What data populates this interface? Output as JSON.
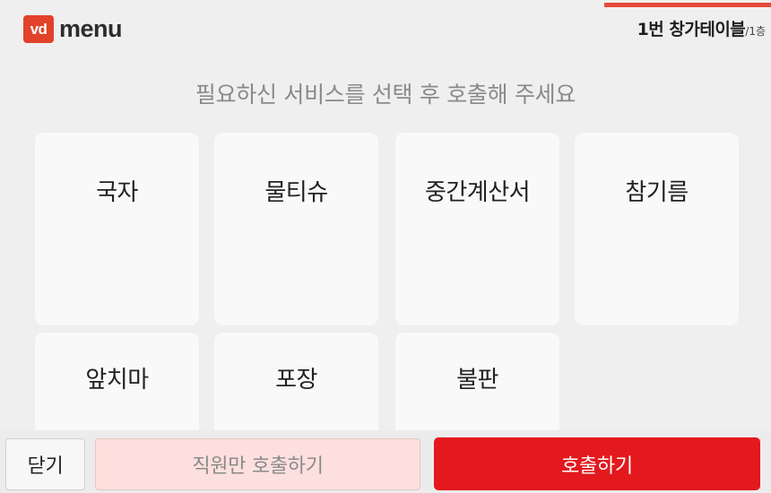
{
  "header": {
    "logo_badge": "vd",
    "logo_text": "menu",
    "table_name": "1번 창가테이블",
    "table_floor": "/1층",
    "accent_color": "#e64a3c"
  },
  "instruction": "필요하신 서비스를 선택 후 호출해 주세요",
  "services": [
    {
      "label": "국자"
    },
    {
      "label": "물티슈"
    },
    {
      "label": "중간계산서"
    },
    {
      "label": "참기름"
    },
    {
      "label": "앞치마"
    },
    {
      "label": "포장"
    },
    {
      "label": "불판"
    }
  ],
  "footer": {
    "close_label": "닫기",
    "staff_only_label": "직원만 호출하기",
    "call_label": "호출하기",
    "call_color": "#e3191d"
  }
}
